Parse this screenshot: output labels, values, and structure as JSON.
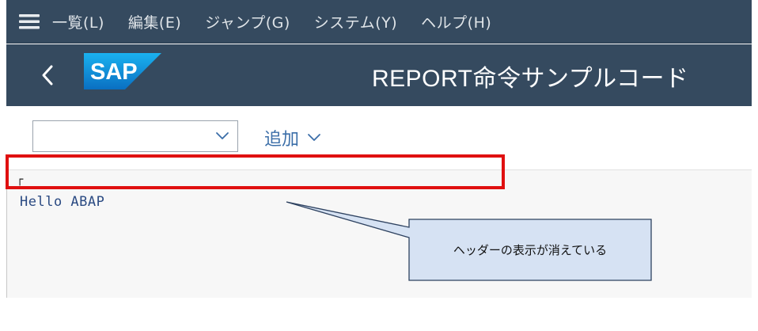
{
  "menubar": {
    "items": [
      {
        "label": "一覧(L)"
      },
      {
        "label": "編集(E)"
      },
      {
        "label": "ジャンプ(G)"
      },
      {
        "label": "システム(Y)"
      },
      {
        "label": "ヘルプ(H)"
      }
    ]
  },
  "titlebar": {
    "logo_text": "SAP",
    "title": "REPORT命令サンプルコード"
  },
  "toolbar": {
    "combo_value": "",
    "add_label": "追加"
  },
  "content": {
    "corner_mark": "┌",
    "output_line": "Hello ABAP"
  },
  "annotation": {
    "callout_text": "ヘッダーの表示が消えている"
  },
  "colors": {
    "shell_bg": "#354a5f",
    "highlight": "#e01010",
    "callout_fill": "#d6e2f3",
    "link_blue": "#3b6ea8"
  }
}
